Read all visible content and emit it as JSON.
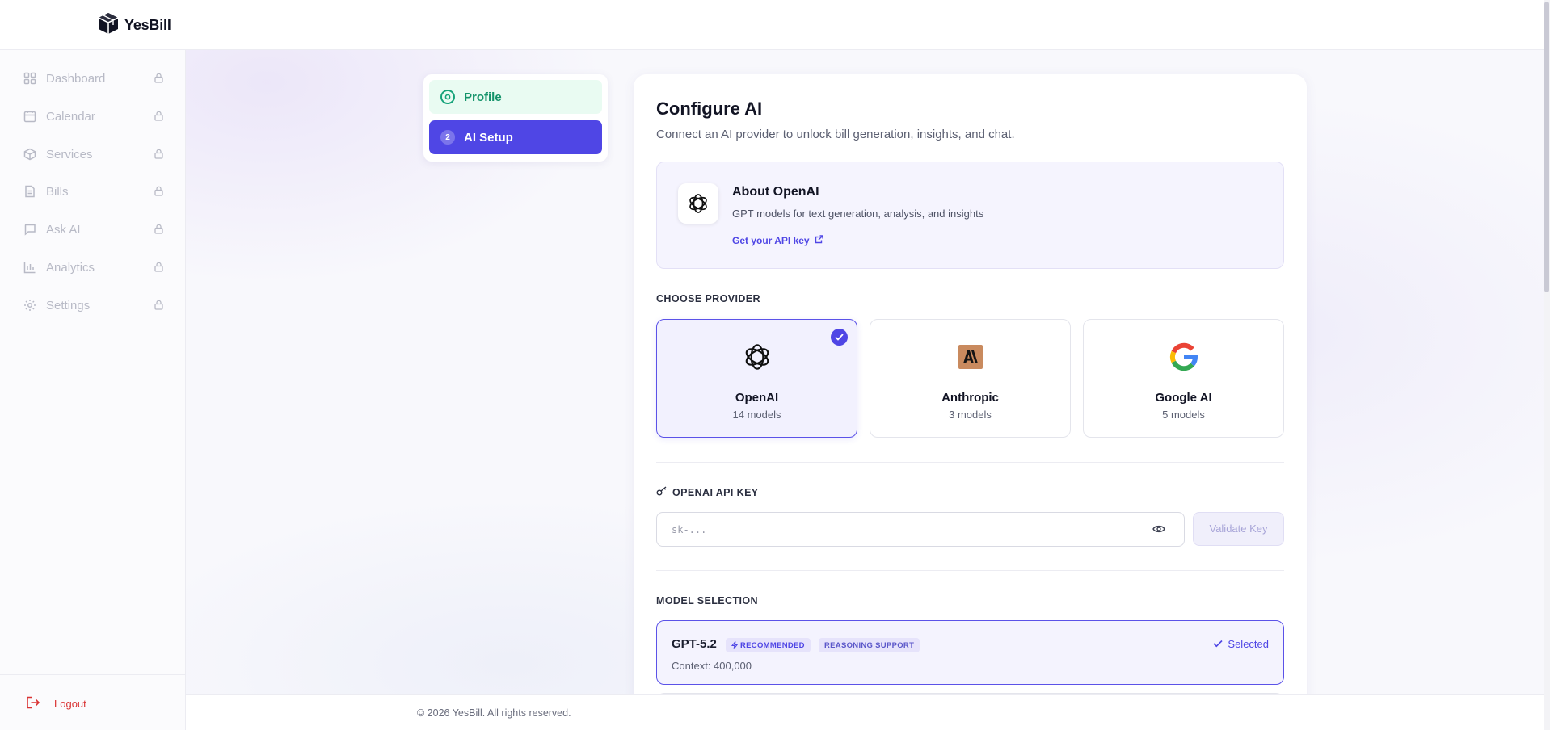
{
  "brand": {
    "name": "YesBill",
    "logo_icon": "cube-logo-icon"
  },
  "sidebar": {
    "items": [
      {
        "label": "Dashboard",
        "icon": "grid-icon"
      },
      {
        "label": "Calendar",
        "icon": "calendar-icon"
      },
      {
        "label": "Services",
        "icon": "box-icon"
      },
      {
        "label": "Bills",
        "icon": "document-icon"
      },
      {
        "label": "Ask AI",
        "icon": "chat-icon"
      },
      {
        "label": "Analytics",
        "icon": "bar-chart-icon"
      },
      {
        "label": "Settings",
        "icon": "gear-icon"
      }
    ],
    "logout_label": "Logout"
  },
  "steps": [
    {
      "number": "1",
      "label": "Profile",
      "state": "completed"
    },
    {
      "number": "2",
      "label": "AI Setup",
      "state": "active"
    }
  ],
  "configure": {
    "title": "Configure AI",
    "subtitle": "Connect an AI provider to unlock bill generation, insights, and chat."
  },
  "about": {
    "title": "About OpenAI",
    "description": "GPT models for text generation, analysis, and insights",
    "link_label": "Get your API key"
  },
  "providers_label": "CHOOSE PROVIDER",
  "providers": [
    {
      "name": "OpenAI",
      "count": "14 models",
      "selected": true
    },
    {
      "name": "Anthropic",
      "count": "3 models",
      "selected": false
    },
    {
      "name": "Google AI",
      "count": "5 models",
      "selected": false
    }
  ],
  "api_key": {
    "label": "OPENAI API KEY",
    "value": "",
    "placeholder": "sk-...",
    "validate_label": "Validate Key"
  },
  "model_selection": {
    "label": "MODEL SELECTION",
    "models": [
      {
        "name": "GPT-5.2",
        "tags": [
          "RECOMMENDED",
          "REASONING SUPPORT"
        ],
        "context": "Context: 400,000",
        "status": "Selected"
      }
    ]
  },
  "footer": {
    "text": "© 2026 YesBill. All rights reserved."
  },
  "colors": {
    "accent": "#4f46e5",
    "success": "#14936a",
    "danger": "#d93333",
    "anthropic_brand": "#c98a5e"
  }
}
